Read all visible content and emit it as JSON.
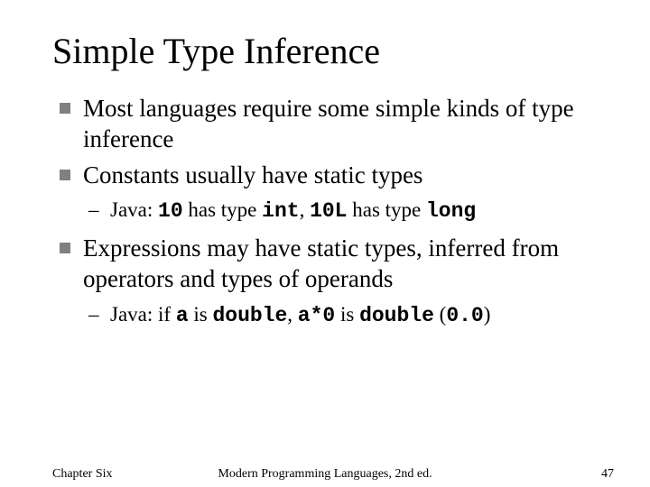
{
  "title": "Simple Type Inference",
  "bullets": {
    "b0": "Most languages require some simple kinds of type inference",
    "b1": "Constants usually have static types",
    "b1sub": {
      "pre": "Java: ",
      "c1": "10",
      "mid1": " has type ",
      "c2": "int",
      "sep": ", ",
      "c3": "10L",
      "mid2": " has type ",
      "c4": "long"
    },
    "b2": "Expressions may have static types, inferred from operators and types of operands",
    "b2sub": {
      "pre": "Java: if ",
      "c1": "a",
      "mid1": " is ",
      "c2": "double",
      "sep": ", ",
      "c3": "a*0",
      "mid2": " is ",
      "c4": "double",
      "open": " (",
      "c5": "0.0",
      "close": ")"
    }
  },
  "footer": {
    "chapter": "Chapter Six",
    "book": "Modern Programming Languages, 2nd ed.",
    "page": "47"
  }
}
